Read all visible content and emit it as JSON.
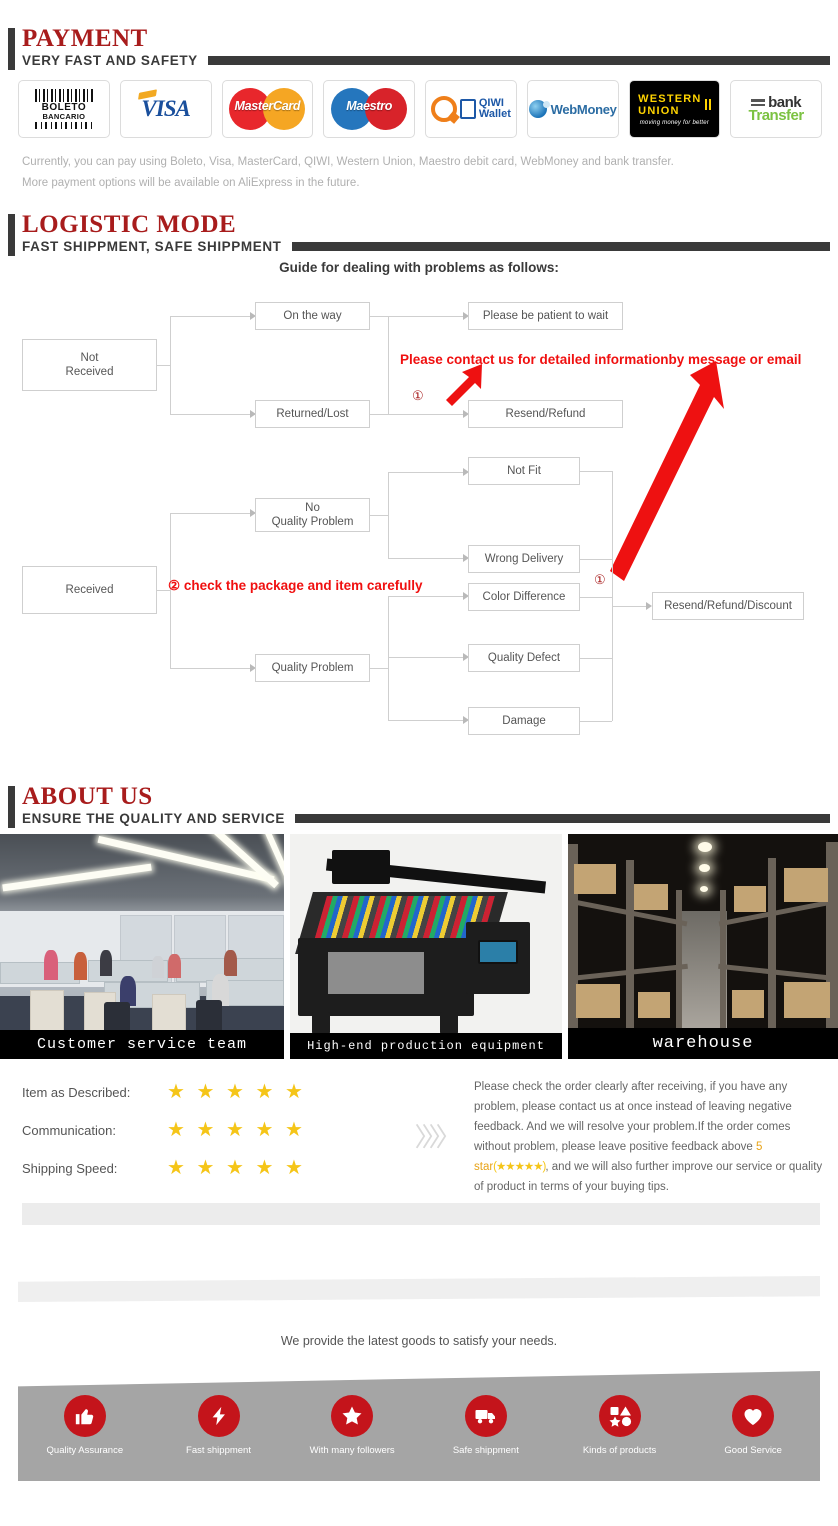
{
  "payment": {
    "title": "PAYMENT",
    "subtitle": "VERY FAST AND SAFETY",
    "logos": [
      {
        "name": "boleto-bancario-logo",
        "line1": "BOLETO",
        "line2": "BANCARIO"
      },
      {
        "name": "visa-logo",
        "text": "VISA"
      },
      {
        "name": "mastercard-logo",
        "text": "MasterCard",
        "color_left": "#e8272c",
        "color_right": "#f5a623"
      },
      {
        "name": "maestro-logo",
        "text": "Maestro",
        "color_left": "#2576bd",
        "color_right": "#d8232a"
      },
      {
        "name": "qiwi-wallet-logo",
        "line1": "QIWI",
        "line2": "Wallet"
      },
      {
        "name": "webmoney-logo",
        "text": "WebMoney"
      },
      {
        "name": "western-union-logo",
        "line1": "WESTERN",
        "line2": "UNION",
        "line3": "moving money for better"
      },
      {
        "name": "bank-transfer-logo",
        "line1": "bank",
        "line2": "Transfer"
      }
    ],
    "note_line1": "Currently, you can pay using Boleto, Visa, MasterCard, QIWI, Western Union, Maestro debit card, WebMoney and bank transfer.",
    "note_line2": "More payment options will be available on AliExpress in the future."
  },
  "logistic": {
    "title": "LOGISTIC MODE",
    "subtitle": "FAST SHIPPMENT, SAFE SHIPPMENT",
    "guide_title": "Guide for dealing with problems as follows:",
    "boxes": {
      "not_received": "Not\nReceived",
      "on_the_way": "On the way",
      "returned_lost": "Returned/Lost",
      "be_patient": "Please be patient to wait",
      "resend_refund": "Resend/Refund",
      "received": "Received",
      "no_quality_problem": "No\nQuality Problem",
      "quality_problem": "Quality Problem",
      "not_fit": "Not Fit",
      "wrong_delivery": "Wrong Delivery",
      "color_difference": "Color Difference",
      "quality_defect": "Quality Defect",
      "damage": "Damage",
      "resend_refund_discount": "Resend/Refund/Discount"
    },
    "note_one": "Please contact us for detailed informationby message or email",
    "note_two": "② check the package and item carefully",
    "marker_one": "①",
    "marker_one_b": "①"
  },
  "about": {
    "title": "ABOUT US",
    "subtitle": "ENSURE THE QUALITY AND SERVICE",
    "photos": [
      {
        "name": "office-photo",
        "caption": "Customer service team"
      },
      {
        "name": "printer-photo",
        "caption": "High-end production equipment"
      },
      {
        "name": "warehouse-photo",
        "caption": "warehouse"
      }
    ]
  },
  "ratings": {
    "rows": [
      {
        "label": "Item as Described:",
        "stars": "★ ★ ★ ★ ★"
      },
      {
        "label": "Communication:",
        "stars": "★ ★ ★ ★ ★"
      },
      {
        "label": "Shipping Speed:",
        "stars": "★ ★ ★ ★ ★"
      }
    ],
    "chevron": "〉〉〉〉",
    "feedback_part1": "Please check the order clearly after receiving, if you have any problem, please contact us at once instead of leaving negative feedback. And we will resolve your problem.If the order comes without problem, please leave positive feedback above ",
    "feedback_highlight": "5 star",
    "feedback_stars": "(★★★★★)",
    "feedback_part2": ", and we will also further improve our service or quality of product in terms of your buying tips."
  },
  "footer": {
    "tagline": "We provide the latest goods to satisfy your needs.",
    "badges": [
      {
        "icon": "thumbs-up-icon",
        "label": "Quality Assurance"
      },
      {
        "icon": "lightning-bolt-icon",
        "label": "Fast shippment"
      },
      {
        "icon": "star-icon",
        "label": "With many followers"
      },
      {
        "icon": "truck-icon",
        "label": "Safe shippment"
      },
      {
        "icon": "shapes-icon",
        "label": "Kinds of products"
      },
      {
        "icon": "heart-icon",
        "label": "Good Service"
      }
    ],
    "accent_color": "#c4141b"
  }
}
